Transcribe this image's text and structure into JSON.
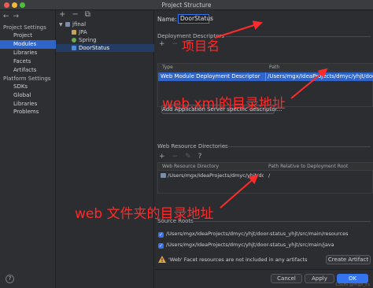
{
  "window": {
    "title": "Project Structure"
  },
  "sidebar": {
    "sections": [
      {
        "title": "Project Settings",
        "items": [
          "Project",
          "Modules",
          "Libraries",
          "Facets",
          "Artifacts"
        ]
      },
      {
        "title": "Platform Settings",
        "items": [
          "SDKs",
          "Global Libraries"
        ]
      }
    ],
    "selected": "Modules",
    "problems": "Problems",
    "help": "?"
  },
  "tree": {
    "toolbar": [
      "+",
      "−",
      "⧉"
    ],
    "nodes": [
      {
        "label": "jfinal",
        "level": 0,
        "icon": "module-folder-icon"
      },
      {
        "label": "JPA",
        "level": 1,
        "icon": "jpa-facet-icon"
      },
      {
        "label": "Spring",
        "level": 1,
        "icon": "spring-facet-icon"
      },
      {
        "label": "DoorStatus",
        "level": 1,
        "icon": "web-facet-icon",
        "selected": true
      }
    ]
  },
  "main": {
    "name_label": "Name:",
    "name_value": "DoorStatus",
    "deployment": {
      "title": "Deployment Descriptors",
      "headers": [
        "Type",
        "Path"
      ],
      "rows": [
        {
          "type": "Web Module Deployment Descriptor",
          "path": "/Users/mgx/IdeaProjects/dmyc/yhjt/door-st"
        }
      ],
      "add_server_button": "Add Application Server specific descriptor..."
    },
    "web_resources": {
      "title": "Web Resource Directories",
      "toolbar": [
        "+",
        "−",
        "✎",
        "?"
      ],
      "headers": [
        "Web Resource Directory",
        "Path Relative to Deployment Root"
      ],
      "rows": [
        {
          "dir": "/Users/mgx/IdeaProjects/dmyc/yhjt/do",
          "relative": "/"
        }
      ]
    },
    "source_roots": {
      "title": "Source Roots",
      "rows": [
        "/Users/mgx/IdeaProjects/dmyc/yhjt/door-status_yhjt/src/main/resources",
        "/Users/mgx/IdeaProjects/dmyc/yhjt/door-status_yhjt/src/main/java"
      ]
    },
    "warning": "'Web' Facet resources are not included in any artifacts",
    "create_artifact": "Create Artifact"
  },
  "footer": {
    "cancel": "Cancel",
    "apply": "Apply",
    "ok": "OK"
  },
  "annotations": {
    "project_name": "项目名",
    "web_xml_dir": "web.xml的目录地址",
    "web_folder_dir": "web 文件夹的目录地址",
    "color": "#ff2b2b"
  },
  "watermark": "CSDN @mgx_cs"
}
